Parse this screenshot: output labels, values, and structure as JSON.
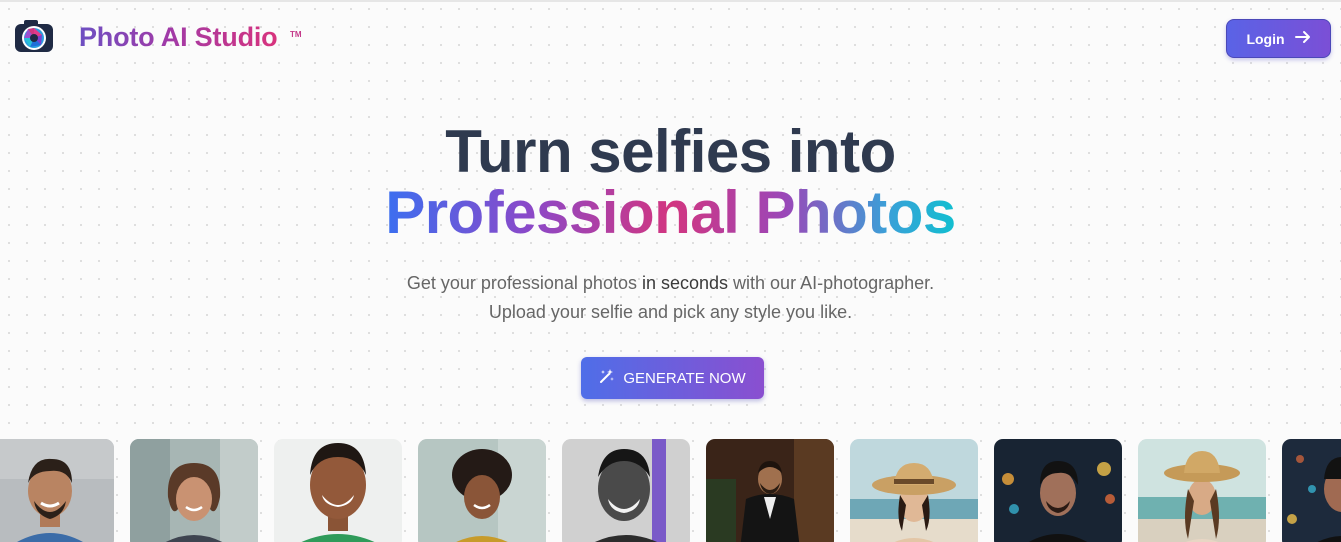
{
  "brand": {
    "name": "Photo AI Studio",
    "trademark": "TM",
    "logo_icon": "camera-aperture-icon"
  },
  "header": {
    "login_label": "Login",
    "login_icon": "arrow-right-icon"
  },
  "hero": {
    "line1": "Turn selfies into",
    "line2": "Professional Photos",
    "subtitle_part1": "Get your professional photos ",
    "subtitle_emphasis": "in seconds",
    "subtitle_part2": " with our AI-photographer.",
    "subtitle_line2": "Upload your selfie and pick any style you like."
  },
  "cta": {
    "label": "GENERATE NOW",
    "icon": "magic-wand-icon"
  },
  "gallery": {
    "items": [
      {
        "name": "man-smiling-blue-shirt"
      },
      {
        "name": "woman-office"
      },
      {
        "name": "man-green-shirt"
      },
      {
        "name": "woman-yellow-top"
      },
      {
        "name": "man-black-white"
      },
      {
        "name": "man-tuxedo"
      },
      {
        "name": "woman-sun-hat-beach"
      },
      {
        "name": "man-city-night"
      },
      {
        "name": "woman-straw-hat-sea"
      },
      {
        "name": "man-night-lights"
      }
    ]
  },
  "colors": {
    "accent": "#5a63e6",
    "brand_pink": "#d8337d",
    "heading": "#2f3a4f"
  }
}
